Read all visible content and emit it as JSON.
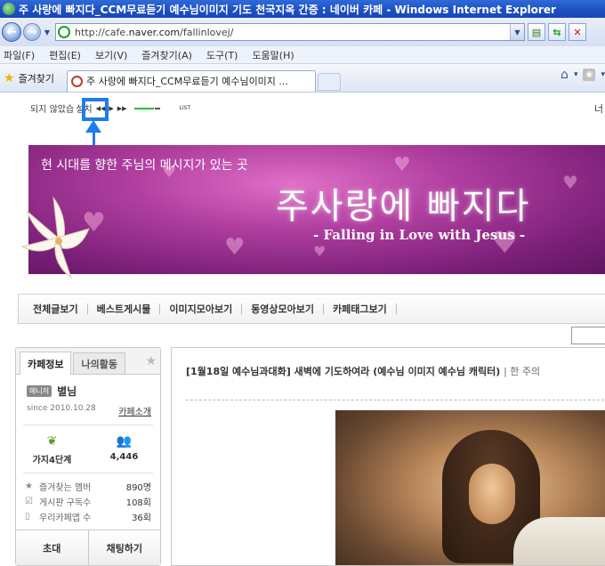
{
  "window": {
    "title": "주 사랑에 빠지다_CCM무료듣기 예수님이미지 기도 천국지옥 간증 : 네이버 카페 - Windows Internet Explorer"
  },
  "address": {
    "url_prefix": "http://cafe.",
    "url_brand": "naver.com",
    "url_suffix": "/fallinlovej/"
  },
  "menu": {
    "items": [
      "파일(F)",
      "편집(E)",
      "보기(V)",
      "즐겨찾기(A)",
      "도구(T)",
      "도움말(H)"
    ]
  },
  "favorites": {
    "label": "즐겨찾기",
    "tab_title": "주 사랑에 빠지다_CCM무료듣기 예수님이미지 ..."
  },
  "player": {
    "notice": "되지 않았습",
    "install": "설치",
    "list": "LIST",
    "right_char": "너"
  },
  "banner": {
    "tagline": "현 시대를 향한 주님의 메시지가 있는 곳",
    "title": "주사랑에 빠지다",
    "subtitle": "- Falling in Love with Jesus -"
  },
  "cafe_menu": {
    "items": [
      "전체글보기",
      "베스트게시물",
      "이미지모아보기",
      "동영상모아보기",
      "카페태그보기"
    ]
  },
  "sidebar": {
    "tab_info": "카페정보",
    "tab_activity": "나의활동",
    "manager_badge": "매니저",
    "manager_name": "별님",
    "since": "since 2010.10.28",
    "intro_link": "카페소개",
    "level": "가지4단계",
    "members": "4,446",
    "rows": [
      {
        "label": "즐겨찾는 멤버",
        "value": "890명"
      },
      {
        "label": "게시판 구독수",
        "value": "108회"
      },
      {
        "label": "우리카페앱 수",
        "value": "36회"
      }
    ],
    "invite_btn": "초대",
    "chat_btn": "채팅하기"
  },
  "article": {
    "title": "[1월18일 예수님과대화] 새벽에 기도하여라 (예수님 이미지 예수님 캐릭터)",
    "title_extra": "| 한 주의"
  },
  "colors": {
    "highlight": "#1e7bf0",
    "banner_purple": "#7a1f78"
  }
}
